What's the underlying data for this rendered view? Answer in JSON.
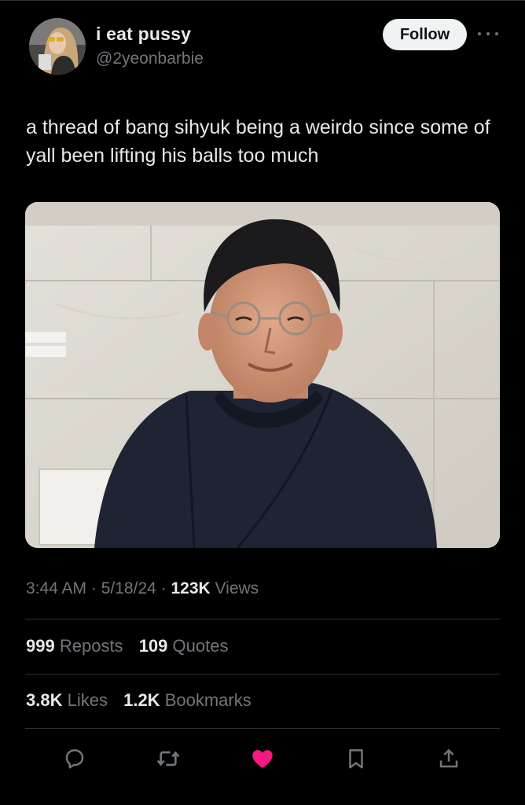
{
  "author": {
    "display_name": "i eat pussy",
    "handle": "@2yeonbarbie",
    "avatar_icon": "avatar-photo"
  },
  "follow_label": "Follow",
  "more_icon": "more-horizontal-icon",
  "tweet_text": "a thread of bang sihyuk being a weirdo since some of yall been lifting his balls too much",
  "media": {
    "kind": "photo",
    "description_icon": "photo"
  },
  "meta": {
    "time": "3:44 AM",
    "sep1": " · ",
    "date": "5/18/24",
    "sep2": " · ",
    "views_count": "123K",
    "views_label": "Views"
  },
  "stats": {
    "reposts_count": "999",
    "reposts_label": "Reposts",
    "quotes_count": "109",
    "quotes_label": "Quotes",
    "likes_count": "3.8K",
    "likes_label": "Likes",
    "bookmarks_count": "1.2K",
    "bookmarks_label": "Bookmarks"
  },
  "actions": [
    {
      "name": "reply",
      "icon": "reply-icon"
    },
    {
      "name": "repost",
      "icon": "repost-icon"
    },
    {
      "name": "like",
      "icon": "heart-icon",
      "active": true
    },
    {
      "name": "bookmark",
      "icon": "bookmark-icon"
    },
    {
      "name": "share",
      "icon": "share-icon"
    }
  ],
  "colors": {
    "background": "#000000",
    "text": "#e7e9ea",
    "secondary": "#71767b",
    "divider": "#2f3336",
    "like_active": "#f91880"
  }
}
